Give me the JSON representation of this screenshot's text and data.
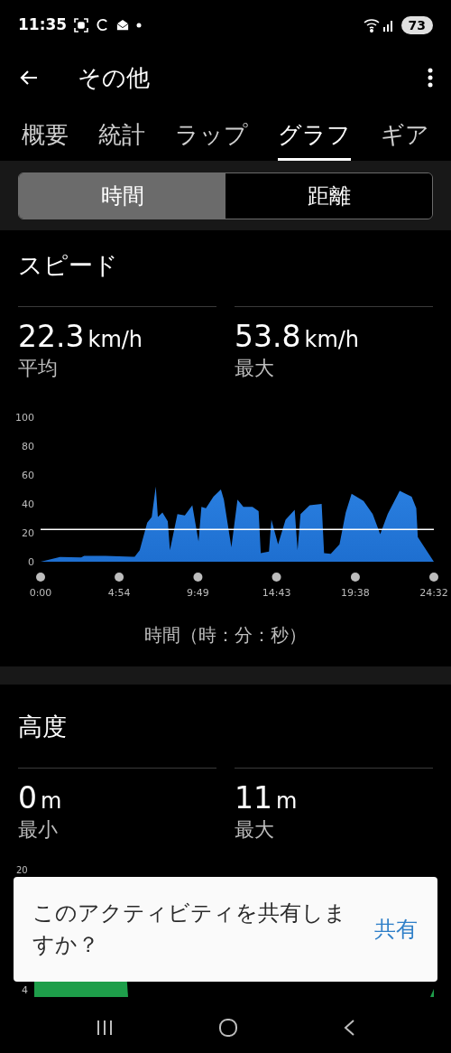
{
  "status_bar": {
    "time": "11:35",
    "battery": "73"
  },
  "header": {
    "title": "その他"
  },
  "tabs": [
    {
      "label": "概要",
      "selected": false
    },
    {
      "label": "統計",
      "selected": false
    },
    {
      "label": "ラップ",
      "selected": false
    },
    {
      "label": "グラフ",
      "selected": true
    },
    {
      "label": "ギア",
      "selected": false
    }
  ],
  "segments": [
    {
      "label": "時間",
      "selected": true
    },
    {
      "label": "距離",
      "selected": false
    }
  ],
  "speed": {
    "title": "スピード",
    "stats": [
      {
        "value": "22.3",
        "unit": "km/h",
        "label": "平均"
      },
      {
        "value": "53.8",
        "unit": "km/h",
        "label": "最大"
      }
    ],
    "chart_data": {
      "type": "area",
      "xlabel": "時間（時：分：秒）",
      "xlim": [
        0,
        1472
      ],
      "ylim": [
        0,
        100
      ],
      "yticks": [
        0,
        20,
        40,
        60,
        80,
        100
      ],
      "xticks": [
        {
          "value": 0,
          "label": "0:00"
        },
        {
          "value": 294,
          "label": "4:54"
        },
        {
          "value": 589,
          "label": "9:49"
        },
        {
          "value": 883,
          "label": "14:43"
        },
        {
          "value": 1178,
          "label": "19:38"
        },
        {
          "value": 1472,
          "label": "24:32"
        }
      ],
      "x": [
        0,
        73,
        152,
        163,
        242,
        343,
        352,
        371,
        399,
        416,
        431,
        439,
        456,
        476,
        484,
        512,
        540,
        568,
        591,
        602,
        619,
        647,
        675,
        686,
        714,
        737,
        759,
        793,
        816,
        824,
        855,
        864,
        889,
        917,
        951,
        962,
        973,
        1007,
        1052,
        1061,
        1086,
        1119,
        1142,
        1164,
        1209,
        1243,
        1271,
        1299,
        1344,
        1389,
        1406,
        1412,
        1472
      ],
      "series": [
        {
          "color": "#2a7fe0",
          "values": [
            0,
            3.3,
            3,
            4,
            4,
            3.5,
            3.5,
            8,
            27,
            31,
            52,
            31,
            34,
            28,
            8,
            33,
            32,
            39,
            14,
            38,
            37,
            45,
            50,
            43,
            10,
            43,
            38,
            38,
            35,
            6,
            7,
            29,
            12,
            29,
            36,
            8,
            33,
            39,
            40,
            6,
            5.5,
            12,
            34,
            47,
            42,
            33,
            19,
            33,
            49,
            45,
            37,
            17,
            0
          ]
        }
      ],
      "ref_lines": [
        {
          "axis": "y",
          "value": 22.3,
          "color": "#ffffff"
        }
      ]
    }
  },
  "altitude": {
    "title": "高度",
    "stats": [
      {
        "value": "0",
        "unit": "m",
        "label": "最小"
      },
      {
        "value": "11",
        "unit": "m",
        "label": "最大"
      }
    ],
    "axis_labels": [
      "20",
      "4"
    ]
  },
  "share_toast": {
    "message": "このアクティビティを共有しますか？",
    "action": "共有"
  }
}
